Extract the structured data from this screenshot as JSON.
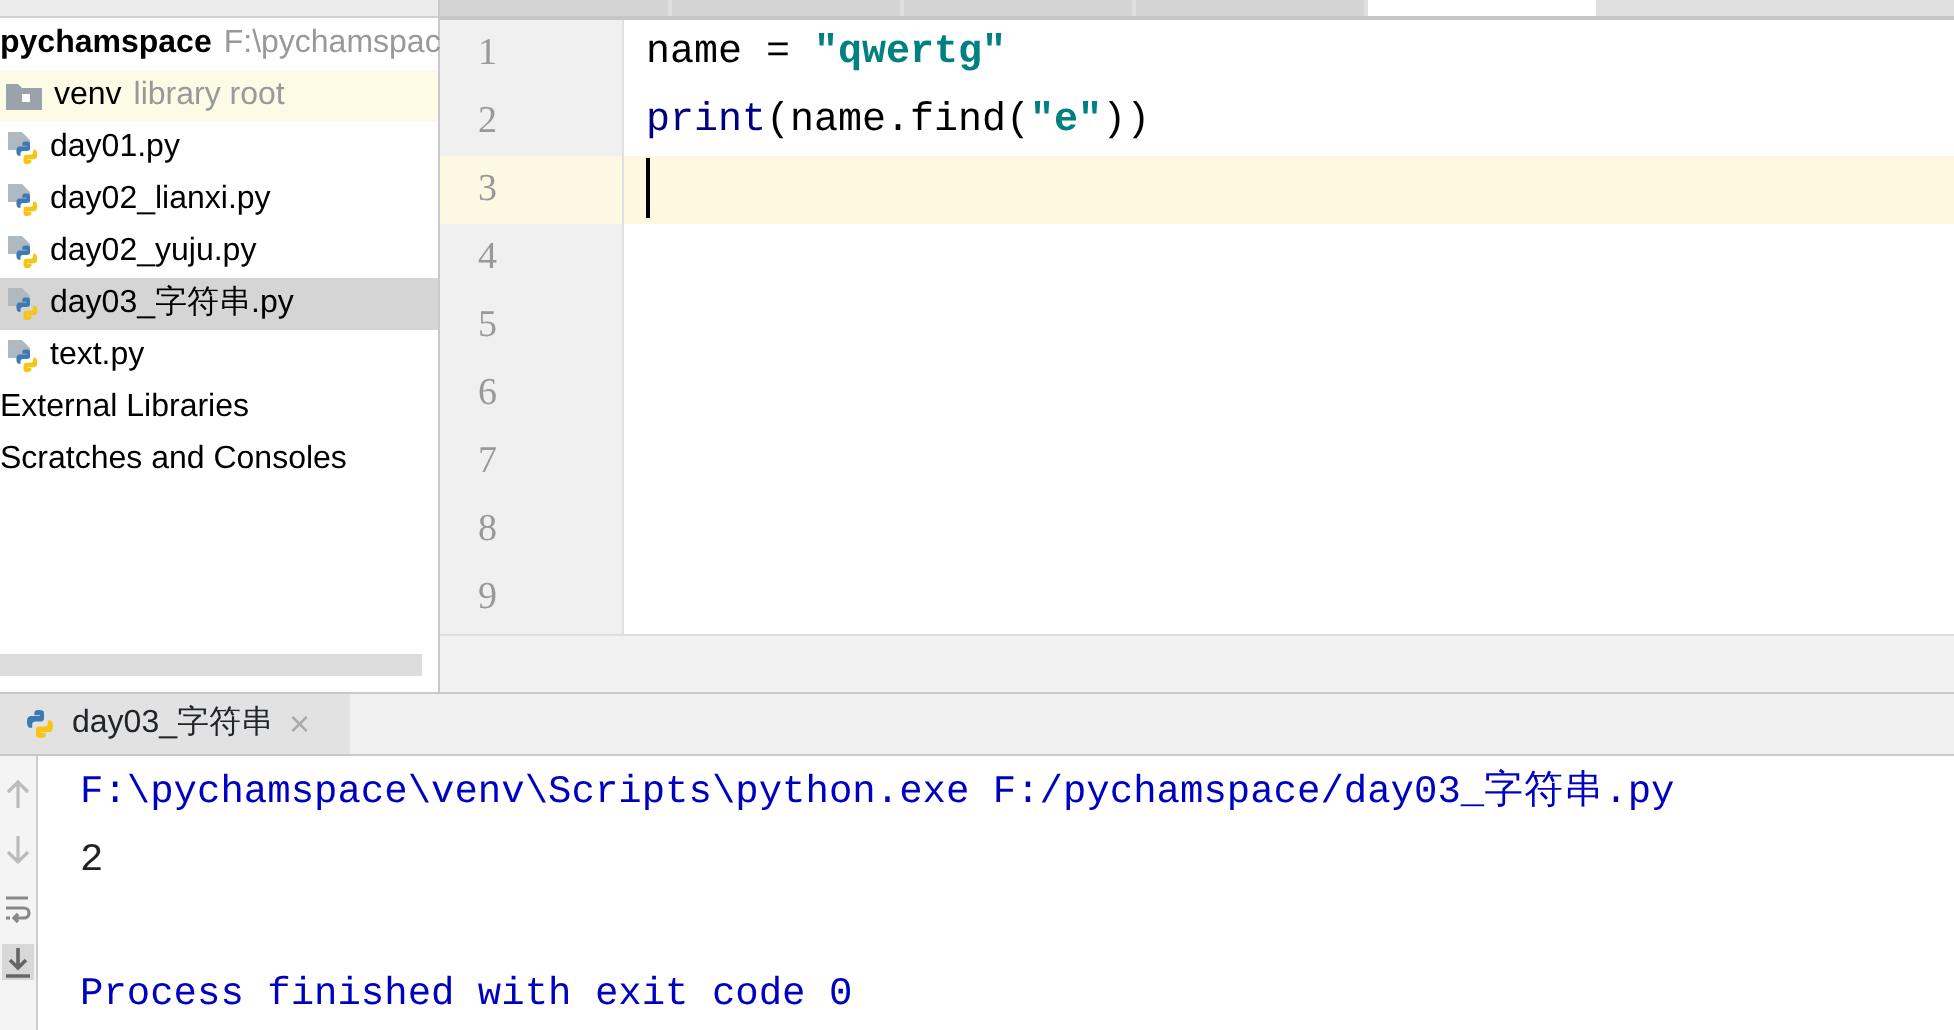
{
  "editor_tabs": [
    {
      "selected": false
    },
    {
      "selected": false
    },
    {
      "selected": false
    },
    {
      "selected": false
    },
    {
      "selected": true
    }
  ],
  "project_tree": [
    {
      "kind": "project",
      "name": "pychamspace",
      "path": "F:\\pychamspac",
      "children": [
        {
          "kind": "folder",
          "name": "venv",
          "note": "library root",
          "highlighted": true
        },
        {
          "kind": "file",
          "name": "day01.py",
          "selected": false
        },
        {
          "kind": "file",
          "name": "day02_lianxi.py",
          "selected": false
        },
        {
          "kind": "file",
          "name": "day02_yuju.py",
          "selected": false
        },
        {
          "kind": "file",
          "name": "day03_字符串.py",
          "selected": true
        },
        {
          "kind": "file",
          "name": "text.py",
          "selected": false
        }
      ]
    },
    {
      "kind": "group",
      "name": "External Libraries"
    },
    {
      "kind": "group",
      "name": "Scratches and Consoles"
    }
  ],
  "editor": {
    "lines": [
      {
        "number": "1",
        "current": false,
        "tokens": [
          {
            "kind": "plain",
            "text": "name = "
          },
          {
            "kind": "string",
            "text": "\"qwertg\""
          }
        ]
      },
      {
        "number": "2",
        "current": false,
        "tokens": [
          {
            "kind": "builtin",
            "text": "print"
          },
          {
            "kind": "plain",
            "text": "(name.find("
          },
          {
            "kind": "string",
            "text": "\"e\""
          },
          {
            "kind": "plain",
            "text": "))"
          }
        ]
      },
      {
        "number": "3",
        "current": true
      },
      {
        "number": "4",
        "current": false
      },
      {
        "number": "5",
        "current": false
      },
      {
        "number": "6",
        "current": false
      },
      {
        "number": "7",
        "current": false
      },
      {
        "number": "8",
        "current": false
      },
      {
        "number": "9",
        "current": false
      }
    ]
  },
  "run_panel": {
    "tab": {
      "title": "day03_字符串",
      "close": "×"
    },
    "tools": [
      {
        "kind": "up",
        "selected": false
      },
      {
        "kind": "down",
        "selected": false
      },
      {
        "kind": "wrap",
        "selected": false
      },
      {
        "kind": "scroll-end",
        "selected": true
      }
    ],
    "output": [
      {
        "kind": "command",
        "text": "F:\\pychamspace\\venv\\Scripts\\python.exe F:/pychamspace/day03_字符串.py"
      },
      {
        "kind": "output",
        "text": "2"
      },
      {
        "kind": "blank"
      },
      {
        "kind": "status",
        "text": "Process finished with exit code 0"
      }
    ]
  }
}
